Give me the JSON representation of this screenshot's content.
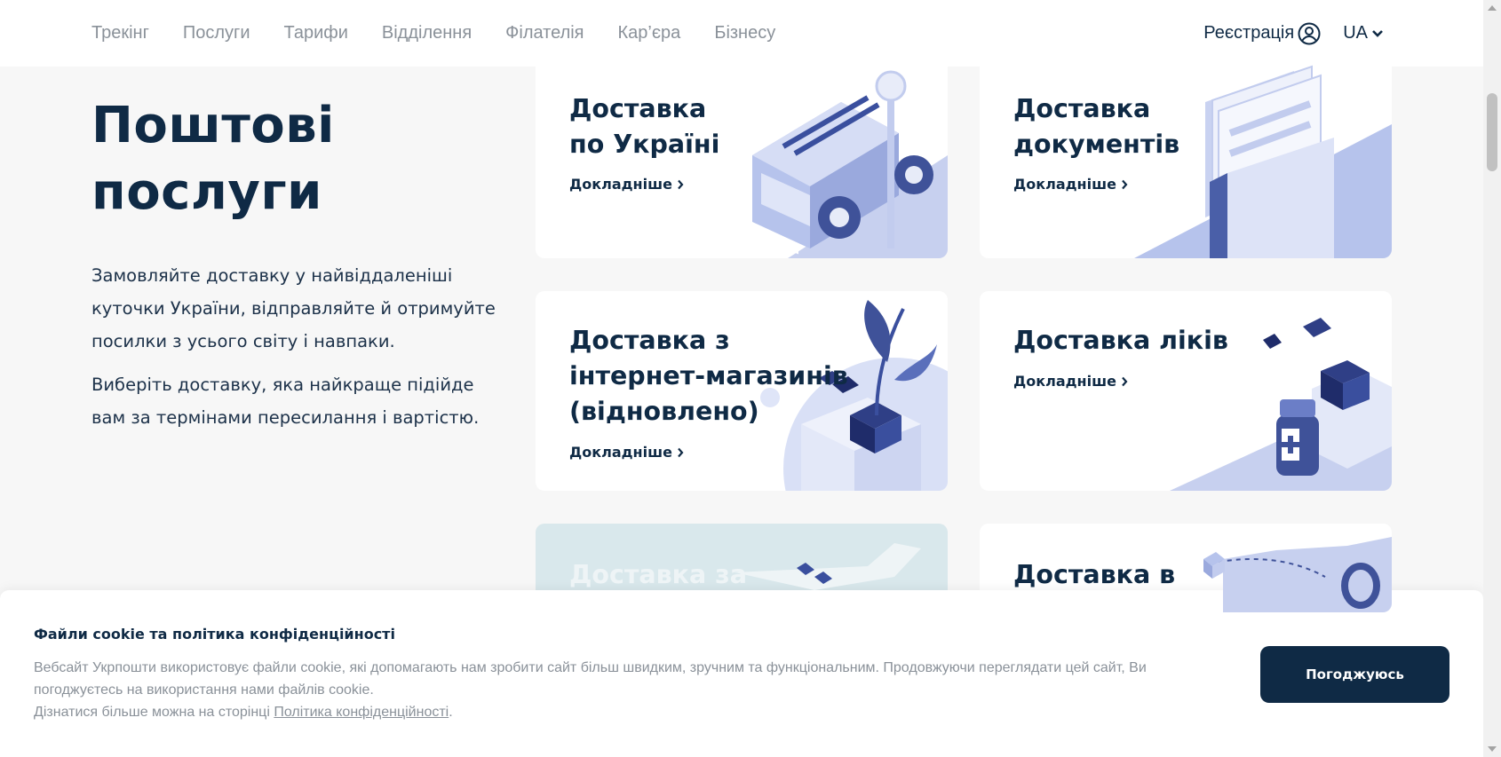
{
  "nav": {
    "items": [
      {
        "label": "Трекінг"
      },
      {
        "label": "Послуги"
      },
      {
        "label": "Тарифи"
      },
      {
        "label": "Відділення"
      },
      {
        "label": "Філателія"
      },
      {
        "label": "Кар’єра"
      },
      {
        "label": "Бізнесу"
      }
    ],
    "register_label": "Реєстрація",
    "language": "UA"
  },
  "hero": {
    "title": "Поштові послуги",
    "paragraph1": "Замовляйте доставку у найвіддаленіші куточки України, відправляйте й отримуйте посилки з усього світу і навпаки.",
    "paragraph2": "Виберіть доставку, яка найкраще підійде вам за термінами пересилання і вартістю."
  },
  "cards": [
    {
      "title": "Доставка по Україні",
      "link": "Докладніше",
      "icon": "delivery-van-icon"
    },
    {
      "title": "Доставка документів",
      "link": "Докладніше",
      "icon": "documents-folder-icon"
    },
    {
      "title": "Доставка з інтернет-магазинів (відновлено)",
      "link": "Докладніше",
      "icon": "box-with-plant-icon"
    },
    {
      "title": "Доставка ліків",
      "link": "Докладніше",
      "icon": "medicine-box-icon"
    },
    {
      "title": "Доставка за",
      "icon": "airplane-icon"
    },
    {
      "title": "Доставка в",
      "icon": "route-map-icon"
    }
  ],
  "cookie": {
    "title": "Файли cookie та політика конфіденційності",
    "text1": "Вебсайт Укрпошти використовує файли cookie, які допомагають нам зробити сайт більш швидким, зручним та функціональним. Продовжуючи переглядати цей сайт, Ви погоджуєтесь на використання нами файлів cookie.",
    "text2_prefix": "Дізнатися більше можна на сторінці ",
    "policy_link": "Політика конфіденційності",
    "text2_suffix": ".",
    "accept_label": "Погоджуюсь"
  },
  "colors": {
    "primary": "#0f2a45",
    "muted": "#8a9199",
    "illustration": "#a9b7e3",
    "background": "#f7f7f7"
  }
}
